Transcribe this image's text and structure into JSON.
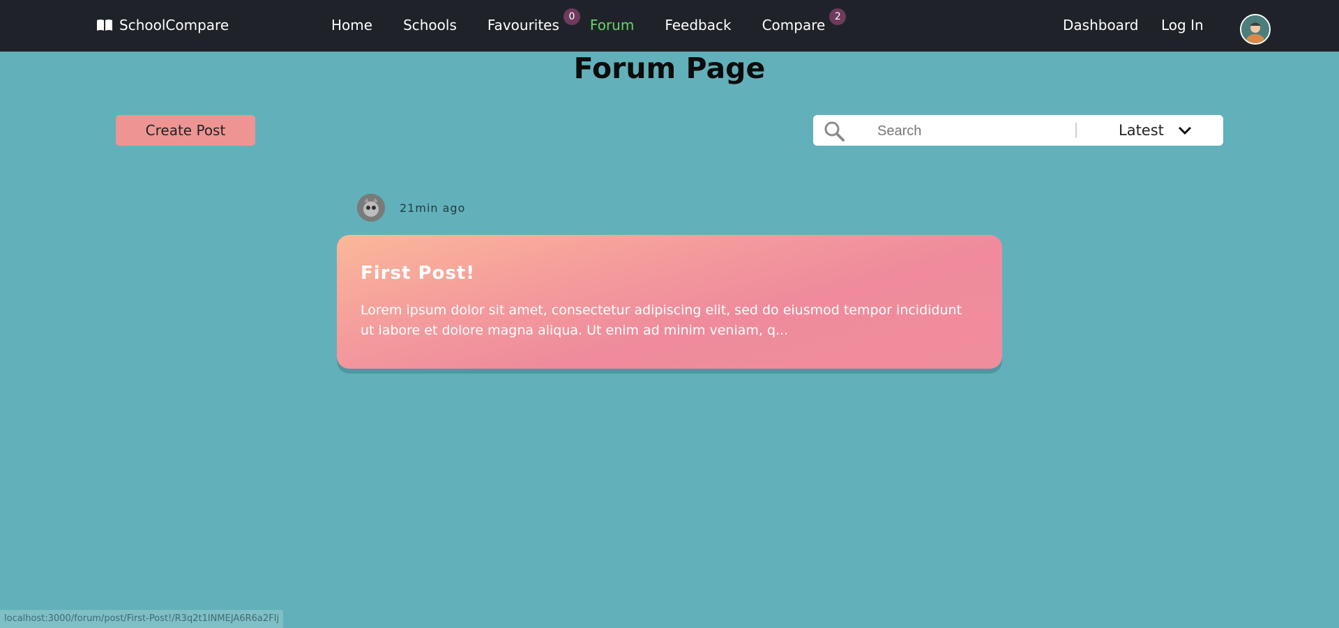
{
  "nav": {
    "brand": "SchoolCompare",
    "links": [
      {
        "label": "Home"
      },
      {
        "label": "Schools"
      },
      {
        "label": "Favourites",
        "badge": "0"
      },
      {
        "label": "Forum",
        "active": true
      },
      {
        "label": "Feedback"
      },
      {
        "label": "Compare",
        "badge": "2"
      }
    ],
    "dashboard": "Dashboard",
    "login": "Log In"
  },
  "page": {
    "title": "Forum Page"
  },
  "toolbar": {
    "create_post": "Create Post",
    "search_placeholder": "Search",
    "search_value": "",
    "sort_selected": "Latest"
  },
  "posts": [
    {
      "time": "21min ago",
      "title": "First Post!",
      "excerpt": "Lorem ipsum dolor sit amet, consectetur adipiscing elit, sed do eiusmod tempor incididunt ut labore et dolore magna aliqua. Ut enim ad minim veniam, q..."
    }
  ],
  "status": {
    "url": "localhost:3000/forum/post/First-Post!/R3q2t1INMEJA6R6a2FIj"
  },
  "colors": {
    "background": "#62b0ba",
    "navbar": "#1f2329",
    "active_link": "#68d36a",
    "badge": "#6f3a5d",
    "create_button": "#ee9594",
    "card_gradient_start": "#fbb899",
    "card_gradient_end": "#ef8b9c"
  },
  "icons": {
    "brand": "open-book-icon",
    "search": "search-icon",
    "sort": "chevron-down-icon",
    "user": "user-avatar"
  }
}
